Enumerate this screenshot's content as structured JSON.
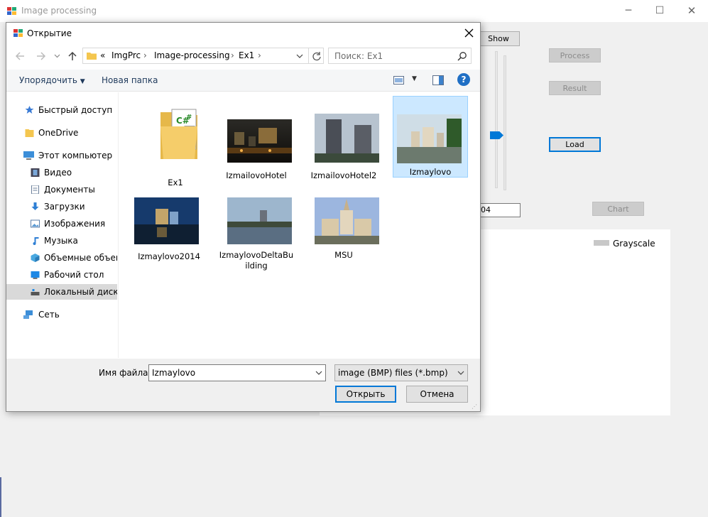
{
  "main_window": {
    "title": "Image processing",
    "controls": {
      "minimize": "─",
      "maximize": "☐",
      "close": "✕"
    },
    "buttons": {
      "show": "Show",
      "process": "Process",
      "result": "Result",
      "load": "Load",
      "chart": "Chart"
    },
    "text_field_value": "04",
    "legend_label": "Grayscale"
  },
  "dialog": {
    "title": "Открытие",
    "address": {
      "overflow": "«",
      "segments": [
        "ImgPrc",
        "Image-processing",
        "Ex1"
      ]
    },
    "search_placeholder": "Поиск: Ex1",
    "toolbar": {
      "organize": "Упорядочить",
      "new_folder": "Новая папка"
    },
    "nav": [
      {
        "label": "Быстрый доступ",
        "icon": "star-icon"
      },
      {
        "label": "OneDrive",
        "icon": "folder-icon"
      },
      {
        "label": "Этот компьютер",
        "icon": "computer-icon"
      },
      {
        "label": "Видео",
        "icon": "video-icon"
      },
      {
        "label": "Документы",
        "icon": "documents-icon"
      },
      {
        "label": "Загрузки",
        "icon": "download-icon"
      },
      {
        "label": "Изображения",
        "icon": "images-icon"
      },
      {
        "label": "Музыка",
        "icon": "music-icon"
      },
      {
        "label": "Объемные объекты",
        "icon": "cube-icon"
      },
      {
        "label": "Рабочий стол",
        "icon": "desktop-icon"
      },
      {
        "label": "Локальный диск (C:)",
        "icon": "drive-icon"
      },
      {
        "label": "Сеть",
        "icon": "network-icon"
      }
    ],
    "files": [
      {
        "name": "Ex1",
        "type": "folder"
      },
      {
        "name": "IzmailovoHotel",
        "type": "image"
      },
      {
        "name": "IzmailovoHotel2",
        "type": "image"
      },
      {
        "name": "Izmaylovo",
        "type": "image",
        "selected": true
      },
      {
        "name": "Izmaylovo2014",
        "type": "image"
      },
      {
        "name": "IzmaylovoDeltaBuilding",
        "type": "image"
      },
      {
        "name": "MSU",
        "type": "image"
      }
    ],
    "filename_label": "Имя файла:",
    "filename_value": "Izmaylovo",
    "filetype": "image (BMP) files (*.bmp)",
    "open_button": "Открыть",
    "cancel_button": "Отмена"
  },
  "colors": {
    "accent": "#0078d7",
    "selection": "#cce8ff",
    "selection_border": "#99d1ff"
  }
}
